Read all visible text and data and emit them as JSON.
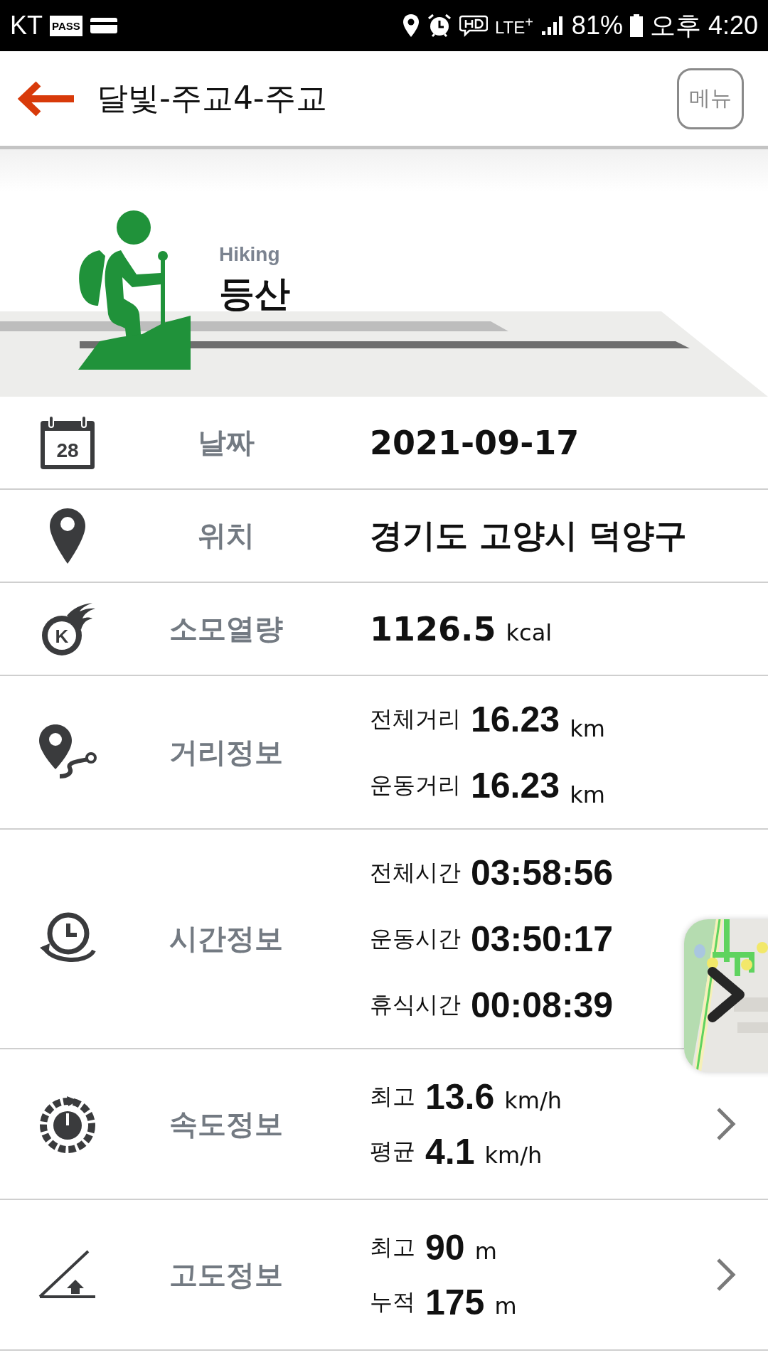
{
  "status_bar": {
    "carrier": "KT",
    "pass_badge": "PASS",
    "network": "LTE$^{+}$",
    "battery": "81%",
    "time": "오후 4:20"
  },
  "header": {
    "title": "달빛-주교4-주교",
    "menu_button": "메뉴"
  },
  "activity": {
    "subtitle": "Hiking",
    "title": "등산"
  },
  "rows": [
    {
      "icon_text": "28",
      "label": "날짜",
      "kind": "single",
      "value": "2021-09-17"
    },
    {
      "label": "위치",
      "kind": "single",
      "value": "경기도 고양시 덕양구"
    },
    {
      "icon_text": "K",
      "label": "소모열량",
      "kind": "single",
      "value": "1126.5",
      "unit": "kcal"
    },
    {
      "label": "거리정보",
      "kind": "lines",
      "lines": [
        {
          "name": "전체거리",
          "value": "16.23",
          "unit": "km"
        },
        {
          "name": "운동거리",
          "value": "16.23",
          "unit": "km"
        }
      ]
    },
    {
      "label": "시간정보",
      "kind": "lines",
      "lines": [
        {
          "name": "전체시간",
          "value": "03:58:56"
        },
        {
          "name": "운동시간",
          "value": "03:50:17"
        },
        {
          "name": "휴식시간",
          "value": "00:08:39"
        }
      ]
    },
    {
      "label": "속도정보",
      "kind": "stats",
      "lines": [
        {
          "name": "최고",
          "value": "13.6",
          "unit": "km/h"
        },
        {
          "name": "평균",
          "value": "4.1",
          "unit": "km/h"
        }
      ]
    },
    {
      "label": "고도정보",
      "kind": "stats",
      "lines": [
        {
          "name": "최고",
          "value": "90",
          "unit": "m"
        },
        {
          "name": "누적",
          "value": "175",
          "unit": "m"
        }
      ]
    }
  ]
}
